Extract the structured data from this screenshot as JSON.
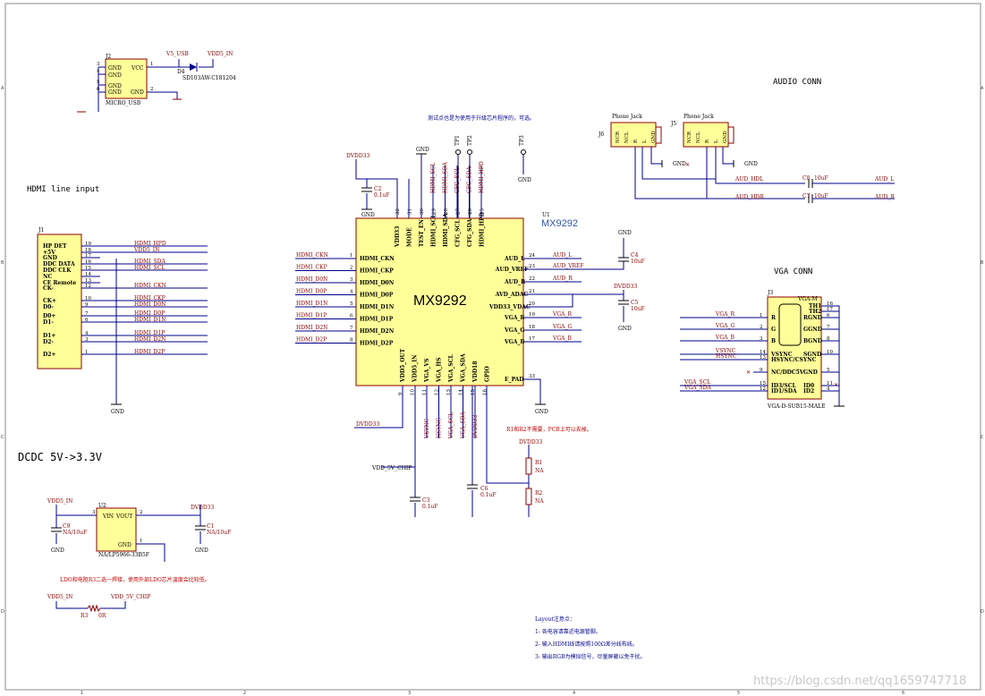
{
  "titles": {
    "hdmi": "HDMI line input",
    "dcdc": "DCDC 5V->3.3V",
    "audio": "AUDIO CONN",
    "vga": "VGA CONN"
  },
  "notes": {
    "test_points": "测试点也是为使用于升级芯片程序的，可选。",
    "r1r2": "R1和R2不需要，PCB上可以去掉。",
    "ldo": "LDO和电阻R3二选一焊接，使用外部LDO芯片温度会比较低。",
    "layout_title": "Layout注意点：",
    "layout1": "1- 各电容请靠近电源管脚。",
    "layout2": "2- 输入HDMI线请按照100Ω差分线布线。",
    "layout3": "3- 输出RGB为模拟信号，尽量屏蔽以免干扰。"
  },
  "watermark": "https://blog.csdn.net/qq1659747718",
  "chip": {
    "name": "MX9292",
    "ref": "U1",
    "part": "MX9292",
    "left_pins": [
      {
        "num": "1",
        "name": "HDMI_CKN",
        "net": "HDMI_CKN"
      },
      {
        "num": "2",
        "name": "HDMI_CKP",
        "net": "HDMI_CKP"
      },
      {
        "num": "3",
        "name": "HDMI_D0N",
        "net": "HDMI_D0N"
      },
      {
        "num": "4",
        "name": "HDMI_D0P",
        "net": "HDMI_D0P"
      },
      {
        "num": "5",
        "name": "HDMI_D1N",
        "net": "HDMI_D1N"
      },
      {
        "num": "6",
        "name": "HDMI_D1P",
        "net": "HDMI_D1P"
      },
      {
        "num": "7",
        "name": "HDMI_D2N",
        "net": "HDMI_D2N"
      },
      {
        "num": "8",
        "name": "HDMI_D2P",
        "net": "HDMI_D2P"
      }
    ],
    "right_pins": [
      {
        "num": "24",
        "name": "AUD_L",
        "net": "AUD_L"
      },
      {
        "num": "23",
        "name": "AUD_VREF",
        "net": "AUD_VREF"
      },
      {
        "num": "22",
        "name": "AUD_R",
        "net": "AUD_R"
      },
      {
        "num": "21",
        "name": "AVD_ADAC",
        "net": ""
      },
      {
        "num": "20",
        "name": "VDD33_VDAC",
        "net": ""
      },
      {
        "num": "19",
        "name": "VGA_R",
        "net": "VGA_R"
      },
      {
        "num": "18",
        "name": "VGA_G",
        "net": "VGA_G"
      },
      {
        "num": "17",
        "name": "VGA_B",
        "net": "VGA_B"
      },
      {
        "num": "33",
        "name": "E_PAD",
        "net": ""
      }
    ],
    "top_pins": [
      {
        "num": "32",
        "name": "VDD33"
      },
      {
        "num": "31",
        "name": "MODE"
      },
      {
        "num": "30",
        "name": "TEST_EN"
      },
      {
        "num": "29",
        "name": "HDMI_SCL"
      },
      {
        "num": "28",
        "name": "HDMI_SDA"
      },
      {
        "num": "27",
        "name": "CFG_SCL"
      },
      {
        "num": "26",
        "name": "CFG_SDA"
      },
      {
        "num": "25",
        "name": "HDMI_HPD"
      }
    ],
    "top_nets": [
      "HDMI_SCL",
      "HDMI_SDA",
      "CFG_SCL",
      "CFG_SDA",
      "HDMI_HPD"
    ],
    "bottom_pins": [
      {
        "num": "9",
        "name": "VDD5_OUT"
      },
      {
        "num": "10",
        "name": "VDD5_IN"
      },
      {
        "num": "11",
        "name": "VGA_VS"
      },
      {
        "num": "12",
        "name": "VGA_HS"
      },
      {
        "num": "13",
        "name": "VGA_SCL"
      },
      {
        "num": "14",
        "name": "VGA_SDA"
      },
      {
        "num": "15",
        "name": "VDD18"
      },
      {
        "num": "16",
        "name": "GPIO"
      }
    ],
    "bottom_nets": [
      "VSYNC",
      "HSYNC",
      "VGA_SCL",
      "VGA_SDA",
      "DVDD33"
    ]
  },
  "labels": {
    "dvdd33": "DVDD33",
    "gnd": "GND",
    "vdd5_in": "VDD5_IN",
    "v5_usb": "V5_USB",
    "vdd_5v_chip": "VDD_5V_CHIP",
    "aud_hdl": "AUD_HDL",
    "aud_hdr": "AUD_HDR",
    "aud_l": "AUD_L",
    "aud_r": "AUD_R",
    "tp1": "TP1",
    "tp2": "TP2",
    "tp3": "TP3"
  },
  "parts": {
    "j2": "J2",
    "micro_usb": "MICRO_USB",
    "d4": "D4",
    "d4_val": "SD103AW-C181204",
    "c2": "C2",
    "c2_val": "0.1uF",
    "c4": "C4",
    "c4_val": "10uF",
    "c5": "C5",
    "c5_val": "10uF",
    "c3": "C3",
    "c3_val": "0.1uF",
    "c6": "C6",
    "c6_val": "0.1uF",
    "r1": "R1",
    "r2": "R2",
    "na": "NA",
    "c7": "C7",
    "c8": "C8",
    "c78_val": "10uF",
    "u2": "U2",
    "u2_val": "NA/LP5966-33B5F",
    "c9": "C9",
    "c9_val": "NA/10uF",
    "c1": "C1",
    "c1_val": "NA/10uF",
    "r3": "R3",
    "r3_val": "0R",
    "j6": "J6",
    "j5": "J5",
    "phone_jack": "Phone Jack",
    "j3": "J3",
    "j1": "J1",
    "vga_conn_name": "VGA-D-SUB15-MALE",
    "vga_m": "VGA-M"
  },
  "usb_pins": {
    "vcc": "VCC",
    "gnd": "GND"
  },
  "ldo_pins": {
    "vin": "VIN",
    "vout": "VOUT",
    "gnd": "GND"
  },
  "hdmi_conn": {
    "pins": [
      {
        "num": "19",
        "name": "HP DET",
        "net": "HDMI_HPD"
      },
      {
        "num": "18",
        "name": "+5V",
        "net": "VDD5_IN"
      },
      {
        "num": "17",
        "name": "GND",
        "net": ""
      },
      {
        "num": "16",
        "name": "DDC DATA",
        "net": "HDMI_SDA"
      },
      {
        "num": "15",
        "name": "DDC CLK",
        "net": "HDMI_SCL"
      },
      {
        "num": "14",
        "name": "NC",
        "net": ""
      },
      {
        "num": "13",
        "name": "CE Remote",
        "net": ""
      },
      {
        "num": "12",
        "name": "CK-",
        "net": "HDMI_CKN"
      },
      {
        "num": "10",
        "name": "CK+",
        "net": "HDMI_CKP"
      },
      {
        "num": "9",
        "name": "D0-",
        "net": "HDMI_D0N"
      },
      {
        "num": "7",
        "name": "D0+",
        "net": "HDMI_D0P"
      },
      {
        "num": "6",
        "name": "D1-",
        "net": "HDMI_D1N"
      },
      {
        "num": "4",
        "name": "D1+",
        "net": "HDMI_D1P"
      },
      {
        "num": "3",
        "name": "D2-",
        "net": "HDMI_D2N"
      },
      {
        "num": "1",
        "name": "D2+",
        "net": "HDMI_D2P"
      }
    ]
  },
  "vga_conn": {
    "pins": [
      {
        "num": "1",
        "name": "R",
        "rname": "RGND",
        "rnum": "6",
        "net": "VGA_R"
      },
      {
        "num": "2",
        "name": "G",
        "rname": "GGND",
        "rnum": "7",
        "net": "VGA_G"
      },
      {
        "num": "3",
        "name": "B",
        "rname": "BGND",
        "rnum": "8",
        "net": "VGA_B"
      },
      {
        "num": "14",
        "name": "VSYNC",
        "rname": "SGND",
        "rnum": "10",
        "net": "VSYNC"
      },
      {
        "num": "13",
        "name": "HSYNC/CSYNC",
        "rname": "",
        "rnum": "",
        "net": "HSYNC"
      },
      {
        "num": "9",
        "name": "NC/DDC5V",
        "rname": "GND",
        "rnum": "5",
        "net": ""
      },
      {
        "num": "15",
        "name": "ID3/SCL",
        "rname": "ID0",
        "rnum": "11",
        "net": "VGA_SCL"
      },
      {
        "num": "12",
        "name": "ID1/SDA",
        "rname": "ID2",
        "rnum": "4",
        "net": "VGA_SDA"
      }
    ],
    "top_right": [
      {
        "name": "TH1",
        "num": "16"
      },
      {
        "name": "TH2",
        "num": "17"
      }
    ]
  },
  "jack_pins": [
    "NCR",
    "NCL",
    "R",
    "L",
    "GND"
  ],
  "border": {
    "cols": [
      "1",
      "2",
      "3",
      "4",
      "5",
      "6"
    ],
    "rows": [
      "A",
      "B",
      "C",
      "D"
    ]
  }
}
